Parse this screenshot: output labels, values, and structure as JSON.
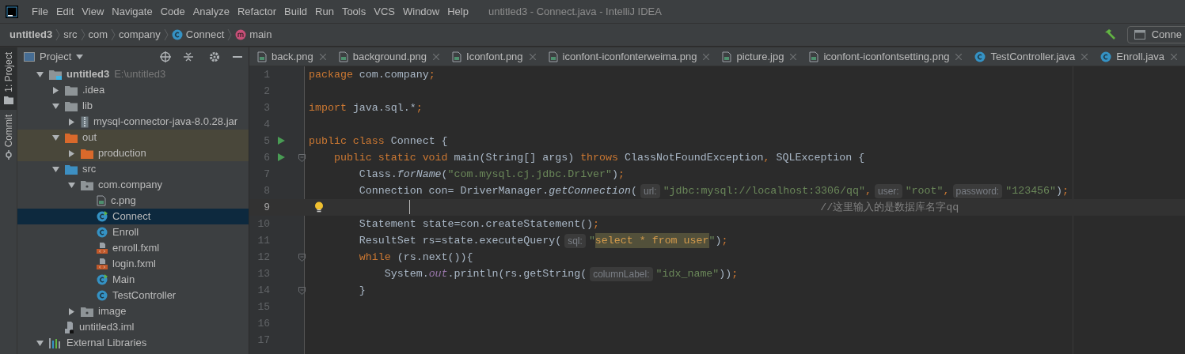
{
  "menu_bar": {
    "items": [
      "File",
      "Edit",
      "View",
      "Navigate",
      "Code",
      "Analyze",
      "Refactor",
      "Build",
      "Run",
      "Tools",
      "VCS",
      "Window",
      "Help"
    ],
    "title": "untitled3 - Connect.java - IntelliJ IDEA"
  },
  "breadcrumbs": [
    {
      "label": "untitled3",
      "kind": "project"
    },
    {
      "label": "src",
      "kind": "plain"
    },
    {
      "label": "com",
      "kind": "plain"
    },
    {
      "label": "company",
      "kind": "plain"
    },
    {
      "label": "Connect",
      "kind": "class"
    },
    {
      "label": "main",
      "kind": "method"
    }
  ],
  "run_config": {
    "label": "Conne"
  },
  "side_strip": [
    {
      "label": "1: Project",
      "selected": true
    },
    {
      "label": "Commit",
      "selected": false
    }
  ],
  "project_panel": {
    "title": "Project",
    "tree": [
      {
        "label": "untitled3",
        "path": "E:\\untitled3",
        "kind": "module",
        "expanded": true,
        "selected": false,
        "children": [
          {
            "label": ".idea",
            "kind": "folder",
            "expanded": false,
            "selected": false
          },
          {
            "label": "lib",
            "kind": "folder",
            "expanded": true,
            "selected": false,
            "children": [
              {
                "label": "mysql-connector-java-8.0.28.jar",
                "kind": "jar",
                "expanded": false,
                "selected": false
              }
            ]
          },
          {
            "label": "out",
            "kind": "excluded",
            "expanded": true,
            "selected": false,
            "children": [
              {
                "label": "production",
                "kind": "excluded",
                "expanded": false,
                "selected": false
              }
            ]
          },
          {
            "label": "src",
            "kind": "source",
            "expanded": true,
            "selected": false,
            "children": [
              {
                "label": "com.company",
                "kind": "package",
                "expanded": true,
                "selected": false,
                "children": [
                  {
                    "label": "c.png",
                    "kind": "image",
                    "selected": false
                  },
                  {
                    "label": "Connect",
                    "kind": "main-class",
                    "selected": true
                  },
                  {
                    "label": "Enroll",
                    "kind": "class",
                    "selected": false
                  },
                  {
                    "label": "enroll.fxml",
                    "kind": "fxml",
                    "selected": false
                  },
                  {
                    "label": "login.fxml",
                    "kind": "fxml",
                    "selected": false
                  },
                  {
                    "label": "Main",
                    "kind": "main-class",
                    "selected": false
                  },
                  {
                    "label": "TestController",
                    "kind": "class",
                    "selected": false
                  }
                ]
              },
              {
                "label": "image",
                "kind": "package",
                "expanded": false,
                "selected": false
              }
            ]
          },
          {
            "label": "untitled3.iml",
            "kind": "iml",
            "selected": false
          }
        ]
      },
      {
        "label": "External Libraries",
        "kind": "libraries",
        "expanded": true,
        "selected": false
      }
    ]
  },
  "editor_tabs": [
    {
      "label": "back.png",
      "kind": "image",
      "selected": false
    },
    {
      "label": "background.png",
      "kind": "image",
      "selected": false
    },
    {
      "label": "Iconfont.png",
      "kind": "image",
      "selected": false
    },
    {
      "label": "iconfont-iconfonterweima.png",
      "kind": "image",
      "selected": false
    },
    {
      "label": "picture.jpg",
      "kind": "image",
      "selected": false
    },
    {
      "label": "iconfont-iconfontsetting.png",
      "kind": "image",
      "selected": false
    },
    {
      "label": "TestController.java",
      "kind": "class",
      "selected": false
    },
    {
      "label": "Enroll.java",
      "kind": "class",
      "selected": false
    }
  ],
  "code_lines": [
    {
      "number": "1",
      "tokens": [
        {
          "kind": "kw",
          "text": "package"
        },
        {
          "kind": "plain",
          "text": " com.company"
        },
        {
          "kind": "kw",
          "text": ";"
        }
      ]
    },
    {
      "number": "2"
    },
    {
      "number": "3",
      "tokens": [
        {
          "kind": "kw",
          "text": "import"
        },
        {
          "kind": "plain",
          "text": " java.sql.*"
        },
        {
          "kind": "kw",
          "text": ";"
        }
      ]
    },
    {
      "number": "4"
    },
    {
      "number": "5",
      "marks": [
        {
          "kind": "run"
        }
      ],
      "tokens": [
        {
          "kind": "kw",
          "text": "public class"
        },
        {
          "kind": "plain",
          "text": " Connect {"
        }
      ]
    },
    {
      "number": "6",
      "marks": [
        {
          "kind": "run"
        },
        {
          "kind": "fold"
        }
      ],
      "tokens": [
        {
          "kind": "kw",
          "text": "    public static void"
        },
        {
          "kind": "plain",
          "text": " main(String[] args) "
        },
        {
          "kind": "kw",
          "text": "throws"
        },
        {
          "kind": "plain",
          "text": " ClassNotFoundException"
        },
        {
          "kind": "kw",
          "text": ","
        },
        {
          "kind": "plain",
          "text": " SQLException {"
        }
      ]
    },
    {
      "number": "7",
      "tokens": [
        {
          "kind": "plain",
          "text": "        Class."
        },
        {
          "kind": "italic",
          "text": "forName"
        },
        {
          "kind": "plain",
          "text": "("
        },
        {
          "kind": "str",
          "text": "\"com.mysql.cj.jdbc.Driver\""
        },
        {
          "kind": "plain",
          "text": ")"
        },
        {
          "kind": "kw",
          "text": ";"
        }
      ]
    },
    {
      "number": "8",
      "tokens": [
        {
          "kind": "plain",
          "text": "        Connection con= DriverManager."
        },
        {
          "kind": "italic",
          "text": "getConnection"
        },
        {
          "kind": "plain",
          "text": "("
        },
        {
          "kind": "hint",
          "text": "url:"
        },
        {
          "kind": "str",
          "text": "\"jdbc:mysql://localhost:3306/qq\""
        },
        {
          "kind": "kw",
          "text": ","
        },
        {
          "kind": "hint",
          "text": "user:"
        },
        {
          "kind": "str",
          "text": "\"root\""
        },
        {
          "kind": "kw",
          "text": ","
        },
        {
          "kind": "hint",
          "text": "password:"
        },
        {
          "kind": "str",
          "text": "\"123456\""
        },
        {
          "kind": "plain",
          "text": ")"
        },
        {
          "kind": "kw",
          "text": ";"
        }
      ]
    },
    {
      "number": "9",
      "current": true,
      "marks": [
        {
          "kind": "bulb"
        }
      ],
      "tokens": [
        {
          "kind": "comment",
          "text": "                                                                                 //这里输入的是数据库名字qq"
        }
      ]
    },
    {
      "number": "10",
      "tokens": [
        {
          "kind": "plain",
          "text": "        Statement state=con.createStatement()"
        },
        {
          "kind": "kw",
          "text": ";"
        }
      ]
    },
    {
      "number": "11",
      "tokens": [
        {
          "kind": "plain",
          "text": "        ResultSet rs=state.executeQuery("
        },
        {
          "kind": "hint",
          "text": "sql:"
        },
        {
          "kind": "str",
          "text": "\""
        },
        {
          "kind": "sql",
          "text": "select * from user"
        },
        {
          "kind": "str",
          "text": "\""
        },
        {
          "kind": "plain",
          "text": ")"
        },
        {
          "kind": "kw",
          "text": ";"
        }
      ]
    },
    {
      "number": "12",
      "marks": [
        {
          "kind": "fold"
        }
      ],
      "tokens": [
        {
          "kind": "kw",
          "text": "        while"
        },
        {
          "kind": "plain",
          "text": " (rs.next()){"
        }
      ]
    },
    {
      "number": "13",
      "tokens": [
        {
          "kind": "plain",
          "text": "            System."
        },
        {
          "kind": "field",
          "text": "out"
        },
        {
          "kind": "plain",
          "text": ".println(rs.getString("
        },
        {
          "kind": "hint",
          "text": "columnLabel:"
        },
        {
          "kind": "str",
          "text": "\"idx_name\""
        },
        {
          "kind": "plain",
          "text": "))"
        },
        {
          "kind": "kw",
          "text": ";"
        }
      ]
    },
    {
      "number": "14",
      "marks": [
        {
          "kind": "fold"
        }
      ],
      "tokens": [
        {
          "kind": "plain",
          "text": "        }"
        }
      ]
    },
    {
      "number": "15"
    },
    {
      "number": "16"
    },
    {
      "number": "17"
    }
  ]
}
